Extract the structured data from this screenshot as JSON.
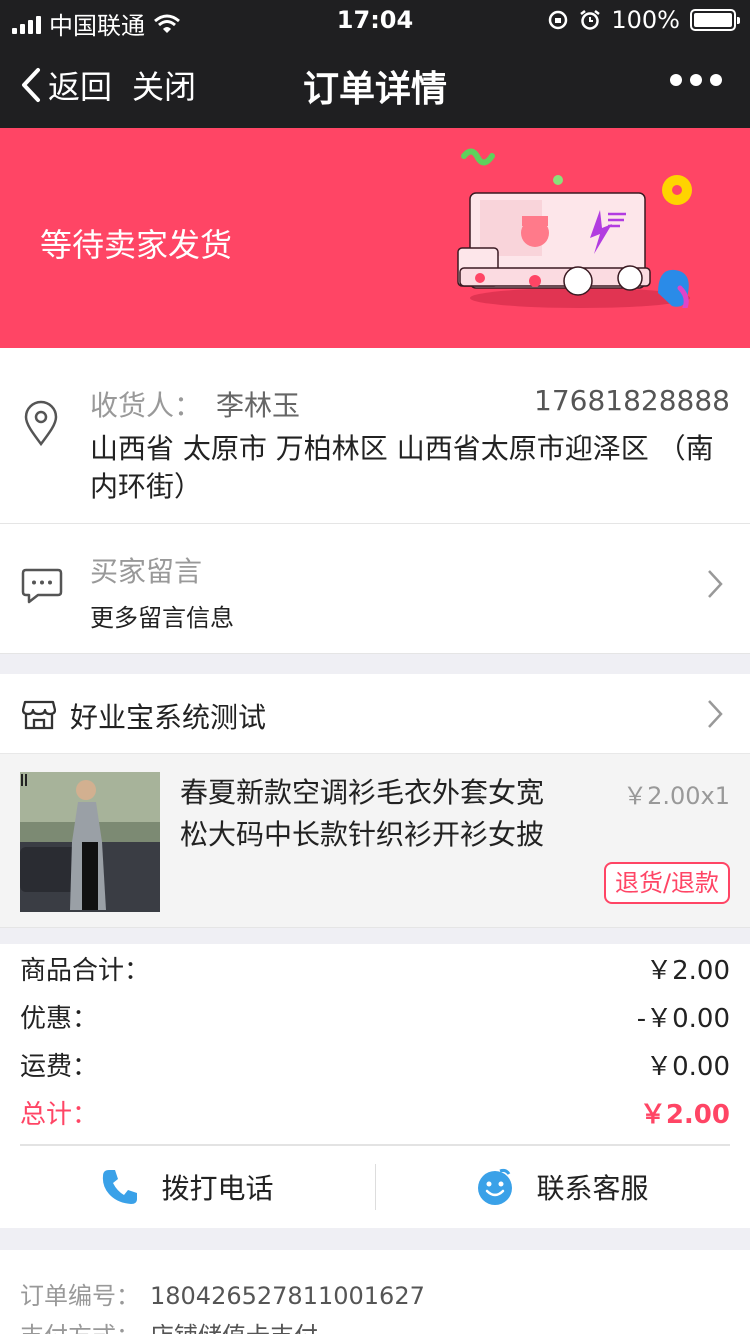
{
  "status_bar": {
    "carrier": "中国联通",
    "time": "17:04",
    "battery": "100%"
  },
  "nav": {
    "back_label": "返回",
    "close_label": "关闭",
    "title": "订单详情"
  },
  "banner": {
    "status_text": "等待卖家发货"
  },
  "address": {
    "consignee_label": "收货人：",
    "consignee_name": "李林玉",
    "phone": "17681828888",
    "full_address": "山西省 太原市 万柏林区 山西省太原市迎泽区 （南内环街）"
  },
  "message": {
    "title": "买家留言",
    "subtitle": "更多留言信息"
  },
  "shop": {
    "name": "好业宝系统测试"
  },
  "product": {
    "title": "春夏新款空调衫毛衣外套女宽松大码中长款针织衫开衫女披",
    "price": "￥2.00x1",
    "refund_label": "退货/退款"
  },
  "totals": {
    "goods_label": "商品合计：",
    "goods_value": "￥2.00",
    "discount_label": "优惠：",
    "discount_value": "-￥0.00",
    "shipping_label": "运费：",
    "shipping_value": "￥0.00",
    "total_label": "总计：",
    "total_value": "￥2.00"
  },
  "actions": {
    "call_label": "拨打电话",
    "service_label": "联系客服"
  },
  "order_info": {
    "order_no_label": "订单编号：",
    "order_no": "180426527811001627",
    "pay_method_label": "支付方式：",
    "pay_method": "店铺储值卡支付"
  },
  "colors": {
    "accent": "#ff4565",
    "nav_bg": "#1f1f21",
    "link_blue": "#3aa1e8"
  },
  "icons": [
    "signal-icon",
    "wifi-icon",
    "orientation-lock-icon",
    "alarm-icon",
    "battery-icon",
    "back-chevron-icon",
    "more-icon",
    "delivery-truck-illustration",
    "location-pin-icon",
    "chat-bubble-icon",
    "chevron-right-icon",
    "store-icon",
    "phone-icon",
    "smiley-service-icon"
  ]
}
